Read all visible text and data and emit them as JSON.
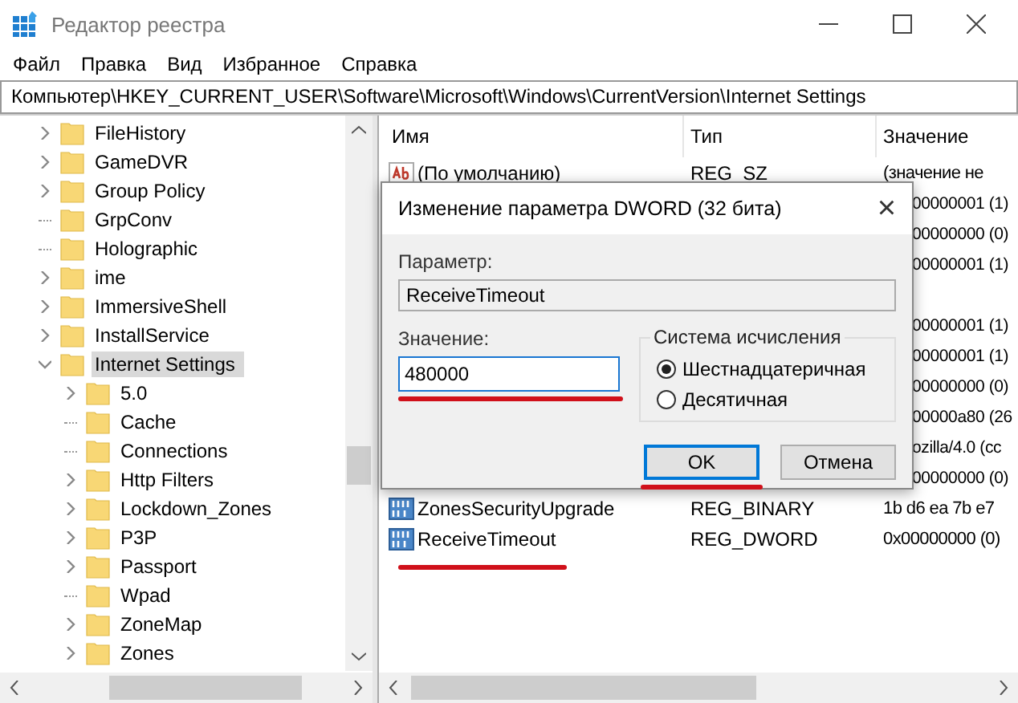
{
  "window": {
    "title": "Редактор реестра"
  },
  "menu": [
    "Файл",
    "Правка",
    "Вид",
    "Избранное",
    "Справка"
  ],
  "address": "Компьютер\\HKEY_CURRENT_USER\\Software\\Microsoft\\Windows\\CurrentVersion\\Internet Settings",
  "tree": [
    {
      "label": "FileHistory",
      "kind": "branch",
      "expanded": false,
      "selected": false
    },
    {
      "label": "GameDVR",
      "kind": "branch",
      "expanded": false,
      "selected": false
    },
    {
      "label": "Group Policy",
      "kind": "branch",
      "expanded": false,
      "selected": false
    },
    {
      "label": "GrpConv",
      "kind": "leaf",
      "selected": false
    },
    {
      "label": "Holographic",
      "kind": "leaf",
      "selected": false
    },
    {
      "label": "ime",
      "kind": "branch",
      "expanded": false,
      "selected": false
    },
    {
      "label": "ImmersiveShell",
      "kind": "branch",
      "expanded": false,
      "selected": false
    },
    {
      "label": "InstallService",
      "kind": "branch",
      "expanded": false,
      "selected": false
    },
    {
      "label": "Internet Settings",
      "kind": "branch",
      "expanded": true,
      "selected": true,
      "children": [
        {
          "label": "5.0",
          "kind": "branch",
          "expanded": false,
          "selected": false
        },
        {
          "label": "Cache",
          "kind": "leaf",
          "selected": false
        },
        {
          "label": "Connections",
          "kind": "leaf",
          "selected": false
        },
        {
          "label": "Http Filters",
          "kind": "branch",
          "expanded": false,
          "selected": false
        },
        {
          "label": "Lockdown_Zones",
          "kind": "branch",
          "expanded": false,
          "selected": false
        },
        {
          "label": "P3P",
          "kind": "branch",
          "expanded": false,
          "selected": false
        },
        {
          "label": "Passport",
          "kind": "branch",
          "expanded": false,
          "selected": false
        },
        {
          "label": "Wpad",
          "kind": "leaf",
          "selected": false
        },
        {
          "label": "ZoneMap",
          "kind": "branch",
          "expanded": false,
          "selected": false
        },
        {
          "label": "Zones",
          "kind": "branch",
          "expanded": false,
          "selected": false
        }
      ]
    }
  ],
  "table": {
    "columns": [
      "Имя",
      "Тип",
      "Значение"
    ],
    "rows": [
      {
        "kind": "string",
        "name": "(По умолчанию)",
        "type": "REG_SZ",
        "value": "(значение не"
      },
      {
        "kind": "covered",
        "value": "00000001 (1)"
      },
      {
        "kind": "covered",
        "value": "00000000 (0)"
      },
      {
        "kind": "covered",
        "value": "00000001 (1)"
      },
      {
        "kind": "covered"
      },
      {
        "kind": "covered",
        "value": "00000001 (1)"
      },
      {
        "kind": "covered",
        "value": "00000001 (1)"
      },
      {
        "kind": "covered",
        "value": "00000000 (0)"
      },
      {
        "kind": "covered",
        "value": "00000a80 (26"
      },
      {
        "kind": "covered",
        "value": "ozilla/4.0 (cc"
      },
      {
        "kind": "covered",
        "value": "00000000 (0)"
      },
      {
        "kind": "binary",
        "name": "ZonesSecurityUpgrade",
        "type": "REG_BINARY",
        "value": "1b d6 ea 7b e7"
      },
      {
        "kind": "binary",
        "name": "ReceiveTimeout",
        "type": "REG_DWORD",
        "value": "0x00000000 (0)"
      }
    ]
  },
  "dialog": {
    "title": "Изменение параметра DWORD (32 бита)",
    "close": "×",
    "name_label": "Параметр:",
    "name_value": "ReceiveTimeout",
    "value_label": "Значение:",
    "value": "480000",
    "base_group": "Система исчисления",
    "bases": [
      {
        "label": "Шестнадцатеричная",
        "selected": true
      },
      {
        "label": "Десятичная",
        "selected": false
      }
    ],
    "buttons": [
      {
        "label": "OK",
        "focused": true
      },
      {
        "label": "Отмена",
        "focused": false
      }
    ]
  }
}
